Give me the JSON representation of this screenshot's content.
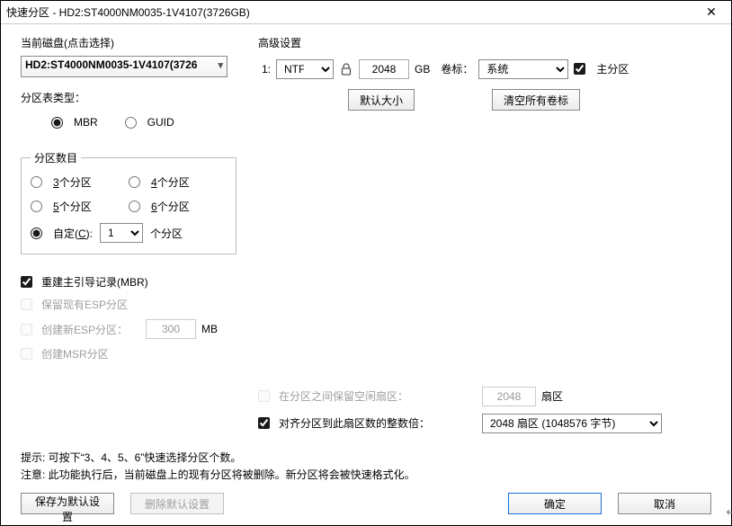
{
  "title": "快速分区 - HD2:ST4000NM0035-1V4107(3726GB)",
  "left": {
    "disk_label": "当前磁盘(点击选择)",
    "disk_value": "HD2:ST4000NM0035-1V4107(3726",
    "table_type_label": "分区表类型：",
    "mbr": "MBR",
    "guid": "GUID",
    "count_legend": "分区数目",
    "p3a": "3",
    "p3b": "个分区",
    "p4a": "4",
    "p4b": "个分区",
    "p5a": "5",
    "p5b": "个分区",
    "p6a": "6",
    "p6b": "个分区",
    "custom_a": "自定(",
    "custom_c": "C",
    "custom_b": "):",
    "custom_value": "1",
    "custom_suffix": "个分区",
    "opt_rebuild": "重建主引导记录(MBR)",
    "opt_keep_esp": "保留现有ESP分区",
    "opt_new_esp": "创建新ESP分区：",
    "esp_size": "300",
    "esp_unit": "MB",
    "opt_msr": "创建MSR分区"
  },
  "right": {
    "adv_label": "高级设置",
    "idx": "1:",
    "fs": "NTFS",
    "size": "2048",
    "size_unit": "GB",
    "vol_label_txt": "卷标：",
    "vol_label_val": "系统",
    "primary": "主分区",
    "btn_default_size": "默认大小",
    "btn_clear_labels": "清空所有卷标",
    "reserve_label": "在分区之间保留空闲扇区：",
    "reserve_val": "2048",
    "reserve_unit": "扇区",
    "align_label": "对齐分区到此扇区数的整数倍：",
    "align_val": "2048 扇区 (1048576 字节)"
  },
  "hints": {
    "l1": "提示: 可按下“3、4、5、6”快速选择分区个数。",
    "l2": "注意: 此功能执行后，当前磁盘上的现有分区将被删除。新分区将会被快速格式化。"
  },
  "footer": {
    "save": "保存为默认设置",
    "delete": "删除默认设置",
    "ok": "确定",
    "cancel": "取消"
  }
}
